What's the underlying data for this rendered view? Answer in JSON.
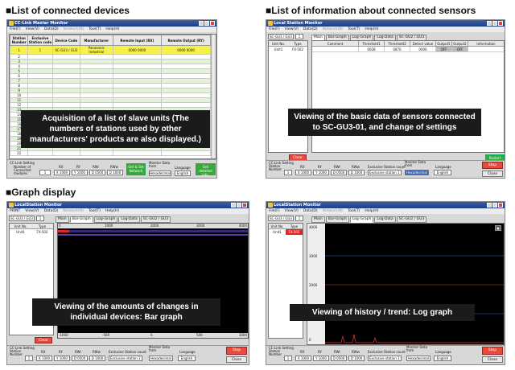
{
  "sections": {
    "s1": "■List of connected devices",
    "s2": "■List of information about connected sensors",
    "s3": "■Graph display"
  },
  "captions": {
    "c1": "Acquisition of a list of slave units (The numbers of stations used by other manufacturers' products are also displayed.)",
    "c2": "Viewing of the basic data of sensors connected to SC-GU3-01, and change of settings",
    "c3": "Viewing of the amounts of changes in individual devices: Bar graph",
    "c4": "Viewing of history / trend: Log graph"
  },
  "win1": {
    "title": "CC-Link Master Monitor",
    "menu": [
      "File(F)",
      "View(V)",
      "Data(D)",
      "Network(N)",
      "Tool(T)",
      "Help(H)"
    ],
    "headers": [
      "Station Number",
      "Exclusive Station code",
      "Device Code",
      "Manufacturer",
      "Remote Input (RX)",
      "Remote Output (RY)"
    ],
    "row1": [
      "1",
      "1",
      "SC-GU3 / GU3",
      "Panasonic Industrial",
      "0000 0000",
      "0000 0000"
    ],
    "rownums": [
      "1",
      "2",
      "3",
      "4",
      "5",
      "6",
      "7",
      "8",
      "9",
      "10",
      "11",
      "12",
      "13",
      "14",
      "15",
      "16",
      "17",
      "18",
      "19",
      "20",
      "21",
      "22"
    ],
    "bottom": {
      "setting": "CC-Link Setting",
      "num_label": "Number of Connected modules",
      "num_val": "1",
      "rx": "RX",
      "rx_val": "X 1000",
      "ry": "RY",
      "ry_val": "Y 1000",
      "rwr": "RWr",
      "rwr_val": "D 0500",
      "rww": "RWw",
      "rww_val": "D 1000",
      "green1": "Get & Set Network",
      "monitor": "Monitor Data from",
      "mon_val": "Hexadecimal",
      "lang": "Language",
      "lang_val": "English",
      "green2": "Get detailed info."
    }
  },
  "win2": {
    "title": "Local Station Monitor",
    "menu": [
      "File(F)",
      "View(V)",
      "Data(D)",
      "Network(N)",
      "Tool(T)",
      "Help(H)"
    ],
    "station_sel": "SC-GU3 / GU3",
    "station_num": "1",
    "tabs": [
      "Main",
      "Bar-Graph",
      "Log-Graph",
      "Log-Data",
      "SC-GU2 / GU3"
    ],
    "left_headers": [
      "Unit No.",
      "Type"
    ],
    "left_row": [
      "Unit1",
      "FX-502"
    ],
    "headers": [
      "Comment",
      "Threshold1",
      "Threshold2",
      "Detect value",
      "Output1",
      "Output2",
      "Information"
    ],
    "row1": [
      "",
      "0028",
      "0870",
      "0000",
      "OFF",
      "OFF",
      ""
    ],
    "clear": "Clear",
    "restart": "Restart",
    "bottom": {
      "setting": "CC-Link Setting",
      "station": "Station Number",
      "station_val": "1",
      "rx": "RX",
      "rx_val": "X 1000",
      "ry": "RY",
      "ry_val": "Y 1000",
      "rwr": "RWr",
      "rwr_val": "D 0500",
      "rww": "RWw",
      "rww_val": "D 1000",
      "excl": "Exclusive Station count",
      "excl_val": "Exclusive station 1",
      "monitor": "Monitor Data from",
      "mon_val": "Hexadecimal",
      "lang": "Language",
      "lang_val": "English",
      "stop": "Stop",
      "close": "Close"
    }
  },
  "win3": {
    "title": "LocalStation Monitor",
    "menu": [
      "PRINT",
      "View(V)",
      "Data(D)",
      "Network(N)",
      "Tool(T)",
      "Help(H)"
    ],
    "station_sel": "SC-GU3 / GU3",
    "station_num": "1",
    "tabs": [
      "Main",
      "Bar-Graph",
      "Log-Graph",
      "Log-Data",
      "SC-GU2 / GU3"
    ],
    "left_headers": [
      "Unit No.",
      "Type"
    ],
    "left_row": [
      "Unit1",
      "FX-502"
    ],
    "scale_top": [
      "0",
      "1000",
      "2000",
      "3000",
      "4000"
    ],
    "scale_bottom": [
      "-1000",
      "-500",
      "0",
      "500",
      "1000"
    ],
    "clear": "Clear",
    "bottom": {
      "setting": "CC-Link Setting",
      "station": "Station Number",
      "station_val": "1",
      "rx": "RX",
      "rx_val": "X 1000",
      "ry": "RY",
      "ry_val": "Y 1000",
      "rwr": "RWr",
      "rwr_val": "D 0500",
      "rww": "RWw",
      "rww_val": "D 1000",
      "excl": "Exclusive Station count",
      "excl_val": "Exclusive station 1",
      "monitor": "Monitor Data from",
      "mon_val": "Hexadecimal",
      "lang": "Language",
      "lang_val": "English",
      "stop": "Stop",
      "close": "Close"
    }
  },
  "win4": {
    "title": "LocalStation Monitor",
    "menu": [
      "File(F)",
      "View(V)",
      "Data(D)",
      "Network(N)",
      "Tool(T)",
      "Help(H)"
    ],
    "station_sel": "SC-GU3 / GU3",
    "station_num": "1",
    "tabs": [
      "Main",
      "Bar-Graph",
      "Log-Graph",
      "Log-Data",
      "SC-GU2 / GU3"
    ],
    "left_headers": [
      "Unit No.",
      "Type"
    ],
    "left_row": [
      "Unit1",
      "FX-502"
    ],
    "yticks": [
      "4000",
      "3000",
      "2000",
      "1000",
      "0"
    ],
    "bottom": {
      "setting": "CC-Link Setting",
      "station": "Station Number",
      "station_val": "1",
      "rx": "RX",
      "rx_val": "X 1000",
      "ry": "RY",
      "ry_val": "Y 1000",
      "rwr": "RWr",
      "rwr_val": "D 0500",
      "rww": "RWw",
      "rww_val": "D 1000",
      "excl": "Exclusive Station count",
      "excl_val": "Exclusive station 1",
      "monitor": "Monitor Data from",
      "mon_val": "Hexadecimal",
      "lang": "Language",
      "lang_val": "English",
      "stop": "Stop",
      "close": "Close"
    }
  }
}
